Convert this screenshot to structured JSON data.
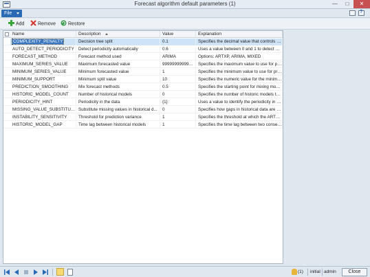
{
  "window": {
    "title": "Forecast algorithm default parameters (1)",
    "minimize_glyph": "—",
    "maximize_glyph": "□",
    "close_glyph": "✕"
  },
  "menu": {
    "file_label": "File"
  },
  "toolbar": {
    "add_label": "Add",
    "remove_label": "Remove",
    "restore_label": "Restore"
  },
  "grid": {
    "columns": {
      "name": "Name",
      "description": "Description",
      "value": "Value",
      "explanation": "Explanation"
    },
    "rows": [
      {
        "name": "COMPLEXITY_PENALTY",
        "description": "Decision tree split",
        "value": "0.1",
        "explanation": "Specifies the decimal value that controls th..."
      },
      {
        "name": "AUTO_DETECT_PERIODICITY",
        "description": "Detect periodicity automatically",
        "value": "0.6",
        "explanation": "Uses a value between 0 and 1 to detect peri..."
      },
      {
        "name": "FORECAST_METHOD",
        "description": "Forecast method used",
        "value": "ARIMA",
        "explanation": "Options: ARTXP, ARIMA, MIXED"
      },
      {
        "name": "MAXIMUM_SERIES_VALUE",
        "description": "Maximum forecasted value",
        "value": "9999999999999...",
        "explanation": "Specifies the maximum value to use for pre..."
      },
      {
        "name": "MINIMUM_SERIES_VALUE",
        "description": "Minimum forecasted value",
        "value": "1",
        "explanation": "Specifies the minimum value to use for pre..."
      },
      {
        "name": "MINIMUM_SUPPORT",
        "description": "Minimum split value",
        "value": "10",
        "explanation": "Specifies the numeric value for the minimu..."
      },
      {
        "name": "PREDICTION_SMOOTHING",
        "description": "Mix forecast methods",
        "value": "0.5",
        "explanation": "Specifies the starting point for mixing mod..."
      },
      {
        "name": "HISTORIC_MODEL_COUNT",
        "description": "Number of historical models",
        "value": "0",
        "explanation": "Specifies the number of historic models tha..."
      },
      {
        "name": "PERIODICITY_HINT",
        "description": "Periodicity in the data",
        "value": "{1}",
        "explanation": "Uses a value to identify the periodicity in th..."
      },
      {
        "name": "MISSING_VALUE_SUBSTITUTI...",
        "description": "Substitute missing values in historical d...",
        "value": "0",
        "explanation": "Specifies how gaps in historical data are fill..."
      },
      {
        "name": "INSTABILITY_SENSITIVITY",
        "description": "Threshold for prediction variance",
        "value": "1",
        "explanation": "Specifies the threshold at which the ARTXP ..."
      },
      {
        "name": "HISTORIC_MODEL_GAP",
        "description": "Time lag between historical models",
        "value": "1",
        "explanation": "Specifies the time lag between two consec..."
      }
    ]
  },
  "status": {
    "alerts": "(1)",
    "company": "initial",
    "user": "admin",
    "close_label": "Close"
  },
  "icons": {
    "app": "window-icon",
    "add": "add-icon",
    "remove": "remove-icon",
    "restore": "restore-icon",
    "bell": "bell-icon"
  },
  "colors": {
    "file_menu": "#2a6ab5",
    "selection": "#3a78c2",
    "close": "#c75050"
  }
}
